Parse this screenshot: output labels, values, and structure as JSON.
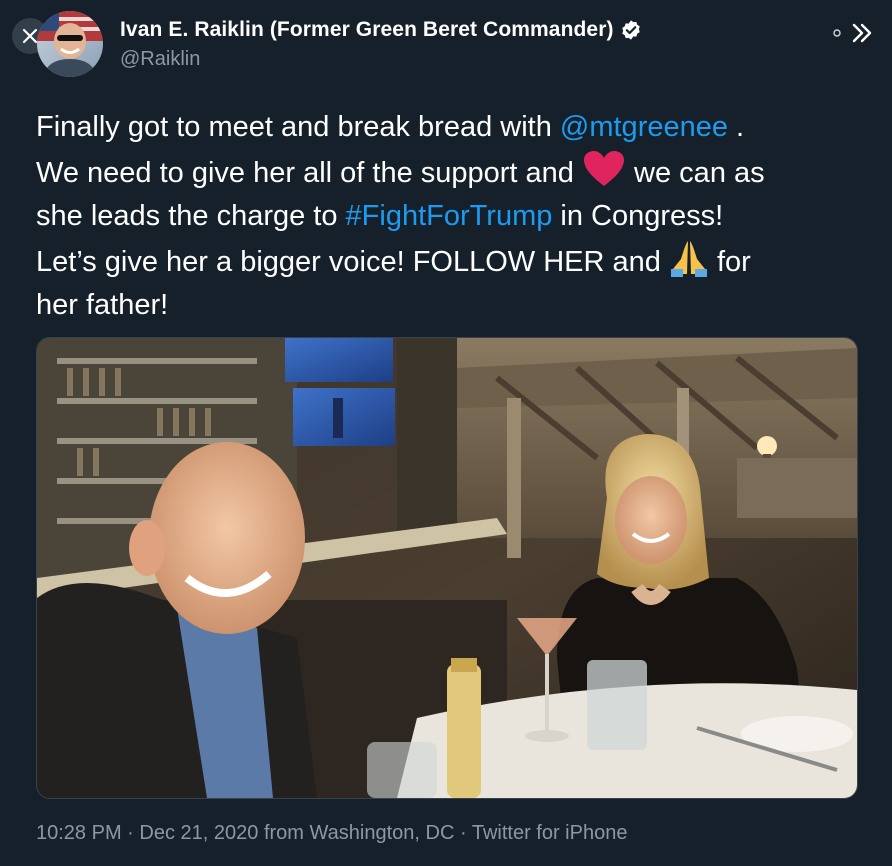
{
  "tweet": {
    "author_name": "Ivan E. Raiklin (Former Green Beret Commander)",
    "handle": "@Raiklin",
    "text": {
      "l1_a": "Finally got to meet and break bread with ",
      "l1_mention": "@mtgreenee",
      "l1_b": " .",
      "l2_a": "We need to give her all of the support and ",
      "l2_b": " we can as",
      "l3_a": "she leads the charge to ",
      "l3_hashtag": "#FightForTrump",
      "l3_b": " in Congress!",
      "l4_a": "Let’s give her a bigger voice!  FOLLOW HER and ",
      "l4_b": " for",
      "l5": "her father!"
    },
    "emojis": [
      "red-heart",
      "folded-hands"
    ],
    "meta": {
      "time": "10:28 PM",
      "date": "Dec 21, 2020",
      "location": "from Washington, DC",
      "source": "Twitter for iPhone",
      "separator": "·"
    }
  },
  "icons": {
    "close": "close-icon",
    "verified": "verified-badge-icon",
    "dot": "dot-icon",
    "expand": "double-chevron-right-icon"
  },
  "colors": {
    "background": "#15202b",
    "link": "#1d9bf0",
    "secondary_text": "#8b98a5",
    "heart": "#e0245e"
  }
}
